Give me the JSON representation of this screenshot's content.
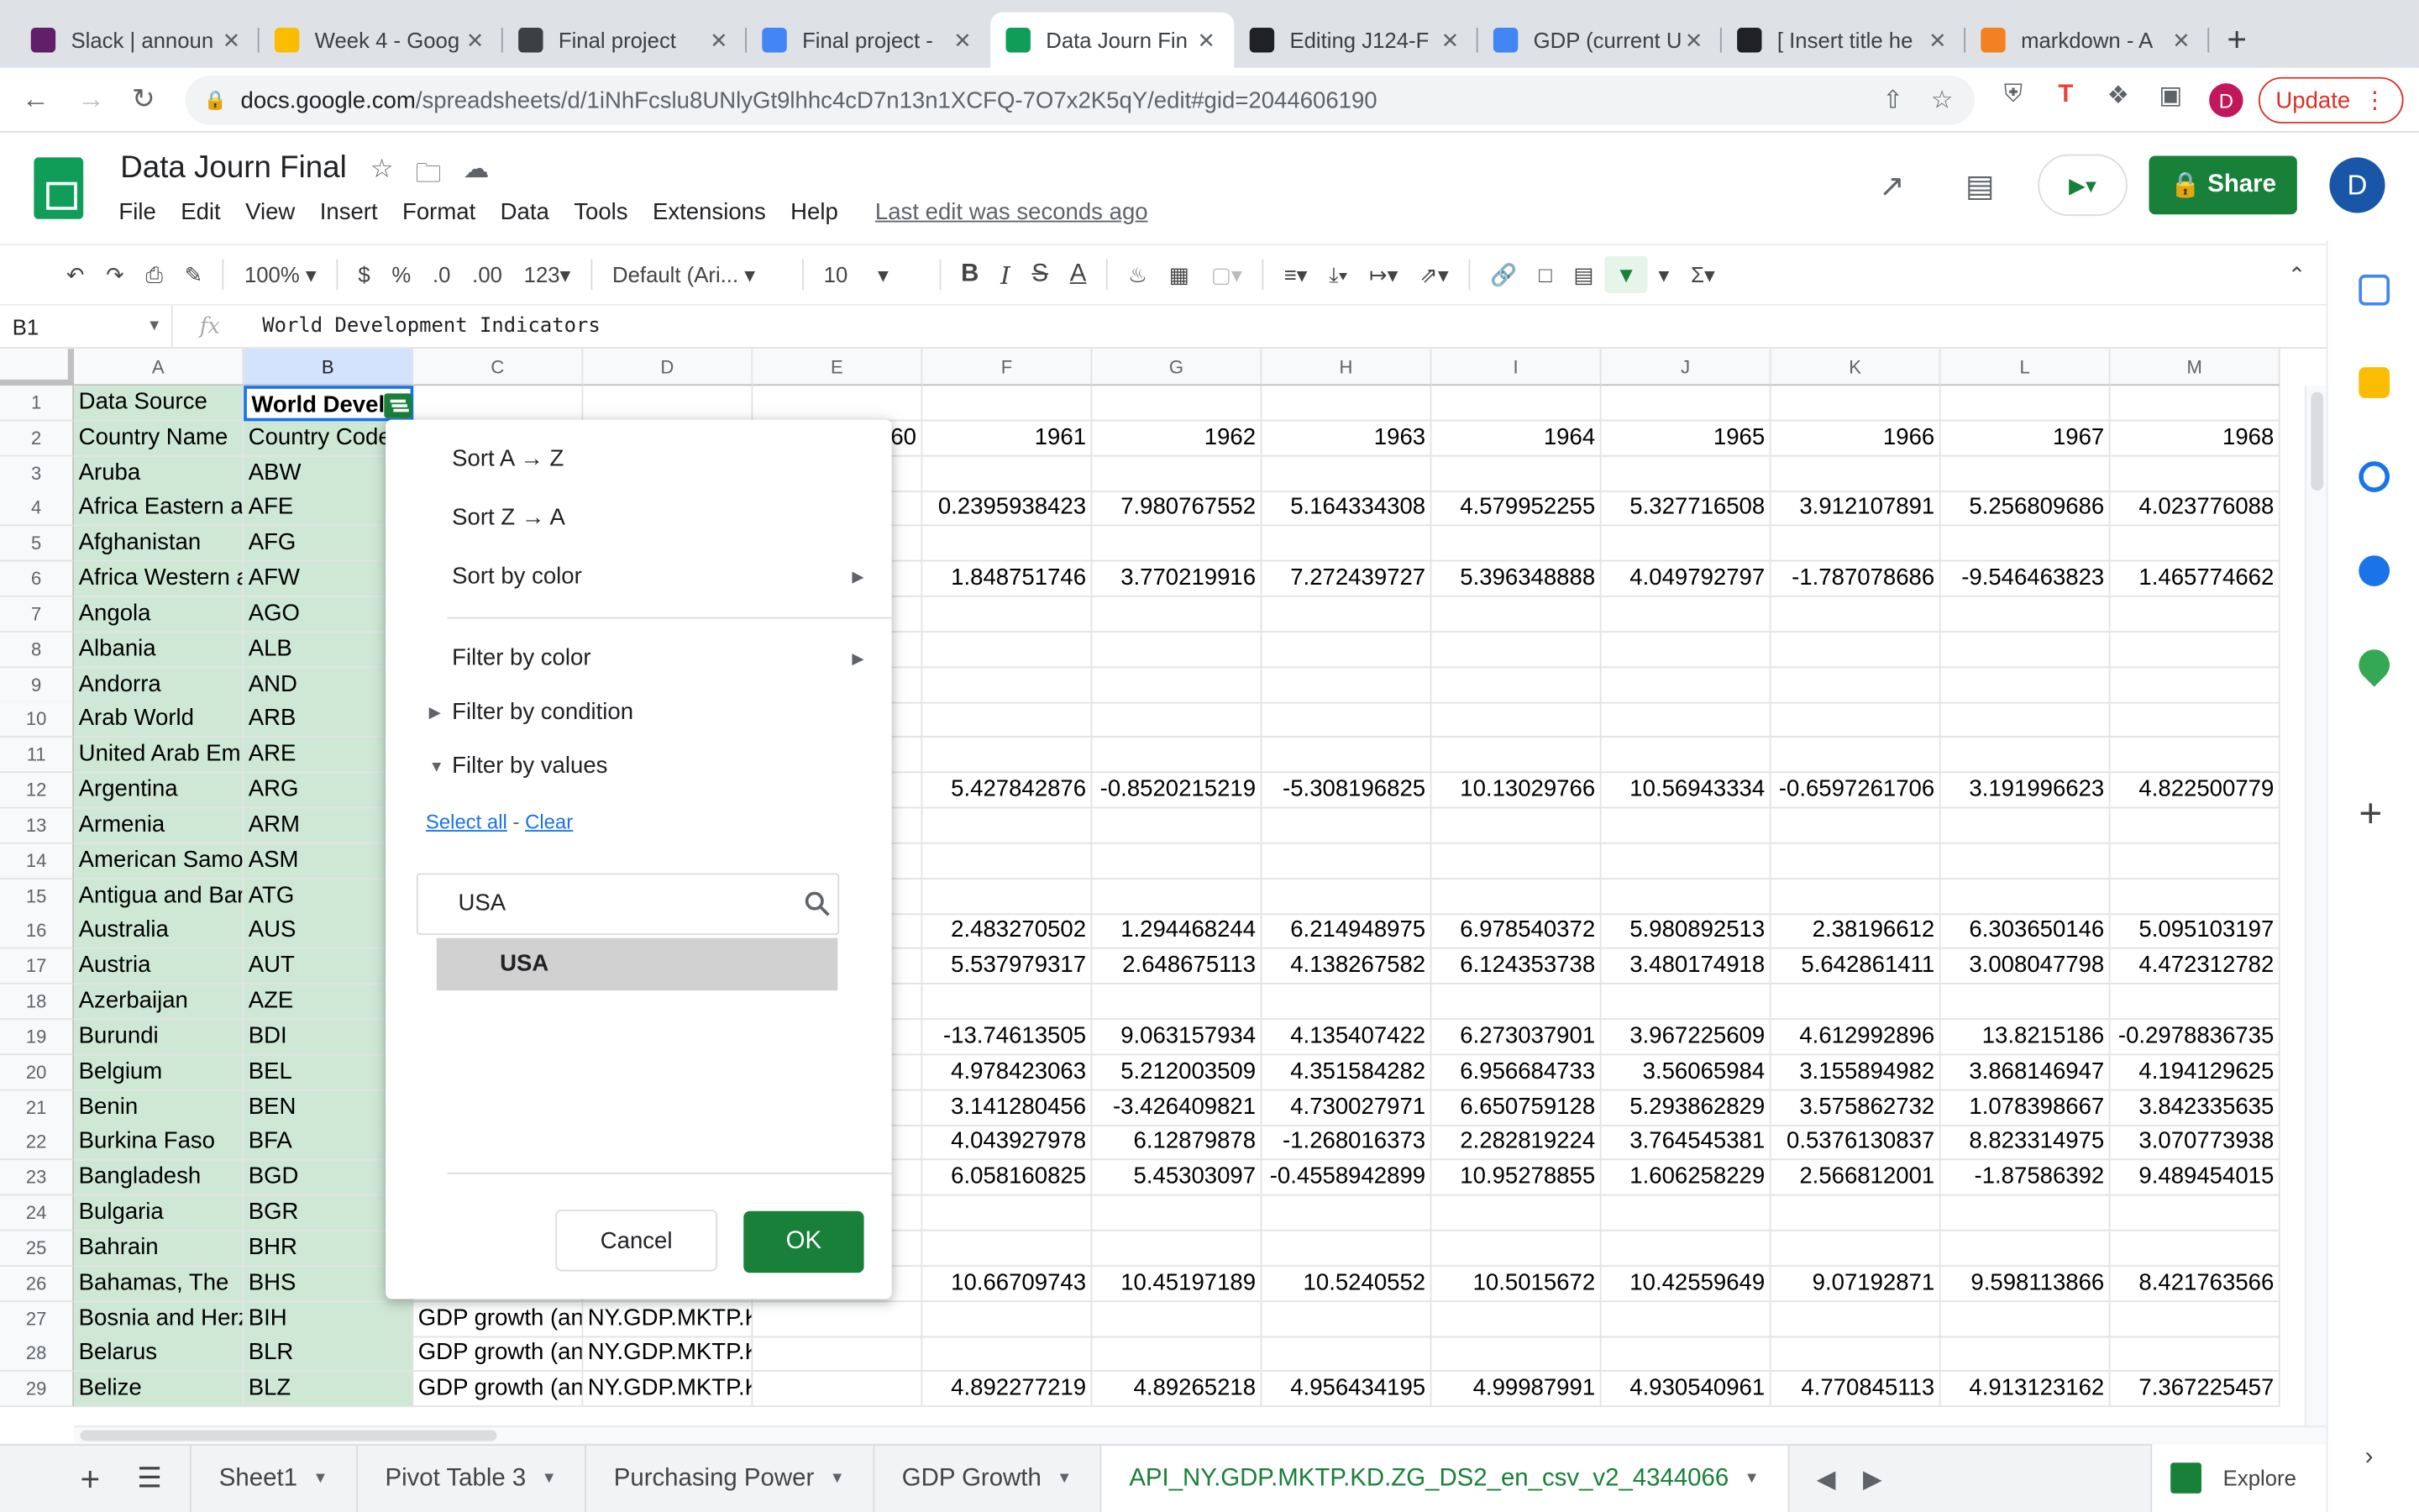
{
  "browser": {
    "tabs": [
      {
        "title": "Slack | announ",
        "color": "#611f69"
      },
      {
        "title": "Week 4 - Goog",
        "color": "#fbbc04"
      },
      {
        "title": "Final project",
        "color": "#3c4043"
      },
      {
        "title": "Final project -",
        "color": "#4285f4"
      },
      {
        "title": "Data Journ Fin",
        "color": "#0f9d58"
      },
      {
        "title": "Editing J124-F",
        "color": "#202124"
      },
      {
        "title": "GDP (current U",
        "color": "#4285f4"
      },
      {
        "title": "[ Insert title he",
        "color": "#202124"
      },
      {
        "title": "markdown - A",
        "color": "#f48024"
      }
    ],
    "url_host": "docs.google.com",
    "url_path": "/spreadsheets/d/1iNhFcslu8UNlyGt9lhhc4cD7n13n1XCFQ-7O7x2K5qY/edit#gid=2044606190",
    "profile_initial": "D",
    "update_label": "Update"
  },
  "app": {
    "title": "Data Journ Final",
    "menus": [
      "File",
      "Edit",
      "View",
      "Insert",
      "Format",
      "Data",
      "Tools",
      "Extensions",
      "Help"
    ],
    "last_edit": "Last edit was seconds ago",
    "share_label": "Share",
    "user_initial": "D"
  },
  "toolbar": {
    "zoom": "100%",
    "currency": "$",
    "percent": "%",
    "dec_less": ".0",
    "dec_more": ".00",
    "format_more": "123",
    "font": "Default (Ari...",
    "font_size": "10"
  },
  "formula_bar": {
    "cell_ref": "B1",
    "fx": "fx",
    "content": "World Development Indicators"
  },
  "grid": {
    "columns": [
      "A",
      "B",
      "C",
      "D",
      "E",
      "F",
      "G",
      "H",
      "I",
      "J",
      "K",
      "L",
      "M"
    ],
    "rows": [
      {
        "n": "1",
        "a": "Data Source",
        "b": "World Devel",
        "c": "",
        "d": "",
        "e": "",
        "v": [
          "",
          "",
          "",
          "",
          "",
          "",
          "",
          ""
        ]
      },
      {
        "n": "2",
        "a": "Country Name",
        "b": "Country Code",
        "c": "",
        "d": "",
        "e": "60",
        "v": [
          "1961",
          "1962",
          "1963",
          "1964",
          "1965",
          "1966",
          "1967",
          "1968"
        ]
      },
      {
        "n": "3",
        "a": "Aruba",
        "b": "ABW",
        "c": "",
        "d": "",
        "e": "",
        "v": [
          "",
          "",
          "",
          "",
          "",
          "",
          "",
          ""
        ]
      },
      {
        "n": "4",
        "a": "Africa Eastern and Southern",
        "b": "AFE",
        "c": "",
        "d": "",
        "e": "",
        "v": [
          "0.2395938423",
          "7.980767552",
          "5.164334308",
          "4.579952255",
          "5.327716508",
          "3.912107891",
          "5.256809686",
          "4.023776088"
        ]
      },
      {
        "n": "5",
        "a": "Afghanistan",
        "b": "AFG",
        "c": "",
        "d": "",
        "e": "",
        "v": [
          "",
          "",
          "",
          "",
          "",
          "",
          "",
          ""
        ]
      },
      {
        "n": "6",
        "a": "Africa Western and Central",
        "b": "AFW",
        "c": "",
        "d": "",
        "e": "",
        "v": [
          "1.848751746",
          "3.770219916",
          "7.272439727",
          "5.396348888",
          "4.049792797",
          "-1.787078686",
          "-9.546463823",
          "1.465774662"
        ]
      },
      {
        "n": "7",
        "a": "Angola",
        "b": "AGO",
        "c": "",
        "d": "",
        "e": "",
        "v": [
          "",
          "",
          "",
          "",
          "",
          "",
          "",
          ""
        ]
      },
      {
        "n": "8",
        "a": "Albania",
        "b": "ALB",
        "c": "",
        "d": "",
        "e": "",
        "v": [
          "",
          "",
          "",
          "",
          "",
          "",
          "",
          ""
        ]
      },
      {
        "n": "9",
        "a": "Andorra",
        "b": "AND",
        "c": "",
        "d": "",
        "e": "",
        "v": [
          "",
          "",
          "",
          "",
          "",
          "",
          "",
          ""
        ]
      },
      {
        "n": "10",
        "a": "Arab World",
        "b": "ARB",
        "c": "",
        "d": "",
        "e": "",
        "v": [
          "",
          "",
          "",
          "",
          "",
          "",
          "",
          ""
        ]
      },
      {
        "n": "11",
        "a": "United Arab Emirates",
        "b": "ARE",
        "c": "",
        "d": "",
        "e": "",
        "v": [
          "",
          "",
          "",
          "",
          "",
          "",
          "",
          ""
        ]
      },
      {
        "n": "12",
        "a": "Argentina",
        "b": "ARG",
        "c": "",
        "d": "",
        "e": "",
        "v": [
          "5.427842876",
          "-0.8520215219",
          "-5.308196825",
          "10.13029766",
          "10.56943334",
          "-0.6597261706",
          "3.191996623",
          "4.822500779"
        ]
      },
      {
        "n": "13",
        "a": "Armenia",
        "b": "ARM",
        "c": "",
        "d": "",
        "e": "",
        "v": [
          "",
          "",
          "",
          "",
          "",
          "",
          "",
          ""
        ]
      },
      {
        "n": "14",
        "a": "American Samoa",
        "b": "ASM",
        "c": "",
        "d": "",
        "e": "",
        "v": [
          "",
          "",
          "",
          "",
          "",
          "",
          "",
          ""
        ]
      },
      {
        "n": "15",
        "a": "Antigua and Barbuda",
        "b": "ATG",
        "c": "",
        "d": "",
        "e": "",
        "v": [
          "",
          "",
          "",
          "",
          "",
          "",
          "",
          ""
        ]
      },
      {
        "n": "16",
        "a": "Australia",
        "b": "AUS",
        "c": "",
        "d": "",
        "e": "",
        "v": [
          "2.483270502",
          "1.294468244",
          "6.214948975",
          "6.978540372",
          "5.980892513",
          "2.38196612",
          "6.303650146",
          "5.095103197"
        ]
      },
      {
        "n": "17",
        "a": "Austria",
        "b": "AUT",
        "c": "",
        "d": "",
        "e": "",
        "v": [
          "5.537979317",
          "2.648675113",
          "4.138267582",
          "6.124353738",
          "3.480174918",
          "5.642861411",
          "3.008047798",
          "4.472312782"
        ]
      },
      {
        "n": "18",
        "a": "Azerbaijan",
        "b": "AZE",
        "c": "",
        "d": "",
        "e": "",
        "v": [
          "",
          "",
          "",
          "",
          "",
          "",
          "",
          ""
        ]
      },
      {
        "n": "19",
        "a": "Burundi",
        "b": "BDI",
        "c": "",
        "d": "",
        "e": "",
        "v": [
          "-13.74613505",
          "9.063157934",
          "4.135407422",
          "6.273037901",
          "3.967225609",
          "4.612992896",
          "13.8215186",
          "-0.2978836735"
        ]
      },
      {
        "n": "20",
        "a": "Belgium",
        "b": "BEL",
        "c": "",
        "d": "",
        "e": "",
        "v": [
          "4.978423063",
          "5.212003509",
          "4.351584282",
          "6.956684733",
          "3.56065984",
          "3.155894982",
          "3.868146947",
          "4.194129625"
        ]
      },
      {
        "n": "21",
        "a": "Benin",
        "b": "BEN",
        "c": "",
        "d": "",
        "e": "",
        "v": [
          "3.141280456",
          "-3.426409821",
          "4.730027971",
          "6.650759128",
          "5.293862829",
          "3.575862732",
          "1.078398667",
          "3.842335635"
        ]
      },
      {
        "n": "22",
        "a": "Burkina Faso",
        "b": "BFA",
        "c": "",
        "d": "",
        "e": "",
        "v": [
          "4.043927978",
          "6.12879878",
          "-1.268016373",
          "2.282819224",
          "3.764545381",
          "0.5376130837",
          "8.823314975",
          "3.070773938"
        ]
      },
      {
        "n": "23",
        "a": "Bangladesh",
        "b": "BGD",
        "c": "",
        "d": "",
        "e": "",
        "v": [
          "6.058160825",
          "5.45303097",
          "-0.4558942899",
          "10.95278855",
          "1.606258229",
          "2.566812001",
          "-1.87586392",
          "9.489454015"
        ]
      },
      {
        "n": "24",
        "a": "Bulgaria",
        "b": "BGR",
        "c": "",
        "d": "",
        "e": "",
        "v": [
          "",
          "",
          "",
          "",
          "",
          "",
          "",
          ""
        ]
      },
      {
        "n": "25",
        "a": "Bahrain",
        "b": "BHR",
        "c": "",
        "d": "",
        "e": "",
        "v": [
          "",
          "",
          "",
          "",
          "",
          "",
          "",
          ""
        ]
      },
      {
        "n": "26",
        "a": "Bahamas, The",
        "b": "BHS",
        "c": "",
        "d": "",
        "e": "",
        "v": [
          "10.66709743",
          "10.45197189",
          "10.5240552",
          "10.5015672",
          "10.42559649",
          "9.07192871",
          "9.598113866",
          "8.421763566"
        ]
      },
      {
        "n": "27",
        "a": "Bosnia and Herzegovina",
        "b": "BIH",
        "c": "GDP growth (annual %)",
        "d": "NY.GDP.MKTP.KD.ZG",
        "e": "",
        "v": [
          "",
          "",
          "",
          "",
          "",
          "",
          "",
          ""
        ]
      },
      {
        "n": "28",
        "a": "Belarus",
        "b": "BLR",
        "c": "GDP growth (annual %)",
        "d": "NY.GDP.MKTP.KD.ZG",
        "e": "",
        "v": [
          "",
          "",
          "",
          "",
          "",
          "",
          "",
          ""
        ]
      },
      {
        "n": "29",
        "a": "Belize",
        "b": "BLZ",
        "c": "GDP growth (annual %)",
        "d": "NY.GDP.MKTP.KD.ZG",
        "e": "",
        "v": [
          "4.892277219",
          "4.89265218",
          "4.956434195",
          "4.99987991",
          "4.930540961",
          "4.770845113",
          "4.913123162",
          "7.367225457"
        ]
      }
    ]
  },
  "filter_popup": {
    "sort_az": "Sort A → Z",
    "sort_za": "Sort Z → A",
    "sort_by_color": "Sort by color",
    "filter_by_color": "Filter by color",
    "filter_by_condition": "Filter by condition",
    "filter_by_values": "Filter by values",
    "select_all": "Select all",
    "link_sep": "-",
    "clear": "Clear",
    "search_value": "USA",
    "result": "USA",
    "cancel": "Cancel",
    "ok": "OK"
  },
  "sheets": {
    "tabs": [
      "Sheet1",
      "Pivot Table 3",
      "Purchasing Power",
      "GDP Growth",
      "API_NY.GDP.MKTP.KD.ZG_DS2_en_csv_v2_4344066"
    ],
    "explore": "Explore"
  }
}
